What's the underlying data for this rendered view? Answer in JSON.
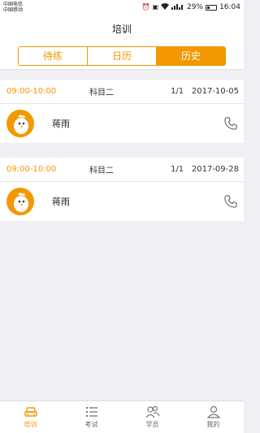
{
  "status_bar": {
    "carrier_1": "中国电信",
    "carrier_2": "中国移动",
    "battery_text": "29%",
    "time": "16:04"
  },
  "header": {
    "title": "培训"
  },
  "segments": {
    "tabs": [
      {
        "label": "待练",
        "active": false
      },
      {
        "label": "日历",
        "active": false
      },
      {
        "label": "历史",
        "active": true
      }
    ]
  },
  "records": [
    {
      "time": "09:00-10:00",
      "subject": "科目二",
      "count": "1/1",
      "date": "2017-10-05",
      "name": "蒋雨"
    },
    {
      "time": "09:00-10:00",
      "subject": "科目二",
      "count": "1/1",
      "date": "2017-09-28",
      "name": "蒋雨"
    }
  ],
  "tabbar": {
    "items": [
      {
        "label": "培训",
        "icon": "car-icon",
        "active": true
      },
      {
        "label": "考试",
        "icon": "list-icon",
        "active": false
      },
      {
        "label": "学员",
        "icon": "students-icon",
        "active": false
      },
      {
        "label": "我的",
        "icon": "person-icon",
        "active": false
      }
    ]
  },
  "colors": {
    "accent": "#f39800",
    "background": "#efeff4"
  }
}
